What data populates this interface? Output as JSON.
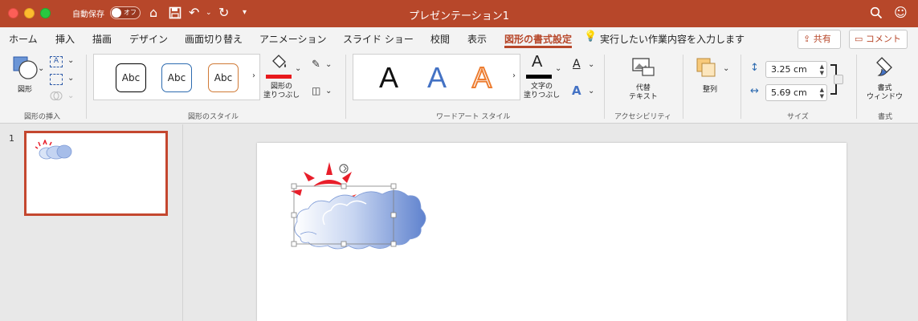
{
  "window": {
    "title": "プレゼンテーション1",
    "autosave_label": "自動保存",
    "autosave_state": "オフ"
  },
  "tabs": [
    {
      "label": "ホーム"
    },
    {
      "label": "挿入"
    },
    {
      "label": "描画"
    },
    {
      "label": "デザイン"
    },
    {
      "label": "画面切り替え"
    },
    {
      "label": "アニメーション"
    },
    {
      "label": "スライド ショー"
    },
    {
      "label": "校閲"
    },
    {
      "label": "表示"
    },
    {
      "label": "図形の書式設定",
      "active": true
    }
  ],
  "tell_me": "実行したい作業内容を入力します",
  "share_label": "共有",
  "comment_label": "コメント",
  "ribbon": {
    "insert_shapes": {
      "shape_label": "図形",
      "group_label": "図形の挿入"
    },
    "shape_styles": {
      "samples": [
        "Abc",
        "Abc",
        "Abc"
      ],
      "fill_label": "図形の\n塗りつぶし",
      "group_label": "図形のスタイル"
    },
    "wordart": {
      "samples": [
        "A",
        "A",
        "A"
      ],
      "text_fill_label": "文字の\n塗りつぶし",
      "group_label": "ワードアート スタイル"
    },
    "accessibility": {
      "alt_text_label": "代替\nテキスト",
      "group_label": "アクセシビリティ"
    },
    "arrange": {
      "label": "整列"
    },
    "size": {
      "height": "3.25 cm",
      "width": "5.69 cm",
      "group_label": "サイズ"
    },
    "format": {
      "pane_label": "書式\nウィンドウ",
      "group_label": "書式"
    }
  },
  "slides": [
    {
      "number": "1"
    }
  ],
  "colors": {
    "accent": "#b7472a",
    "fill_red": "#e8191c",
    "sun": "#e81e2a",
    "cloud_blue": "#6b8dd0"
  }
}
